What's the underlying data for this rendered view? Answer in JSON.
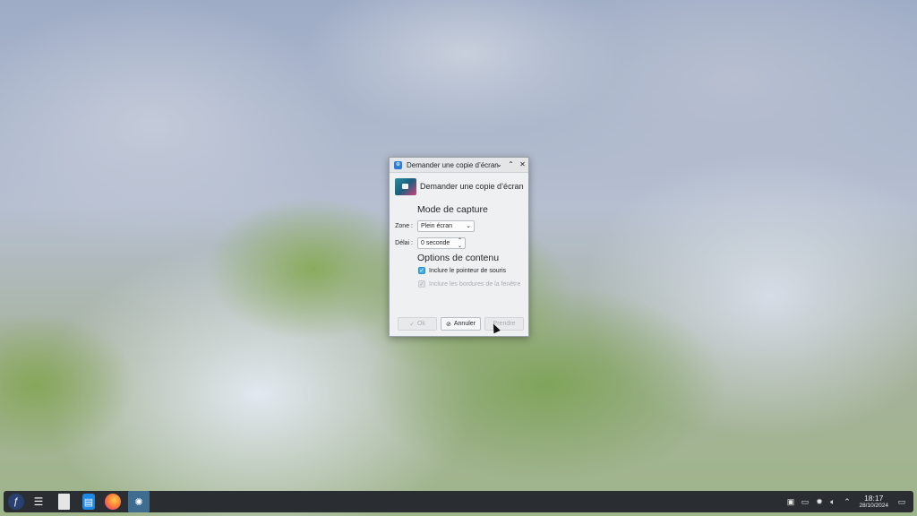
{
  "dialog": {
    "window_title": "Demander une copie d’écran",
    "header_title": "Demander une copie d’écran",
    "section_capture": "Mode de capture",
    "zone_label": "Zone :",
    "zone_value": "Plein écran",
    "delay_label": "Délai :",
    "delay_value": "0 seconde",
    "section_content": "Options de contenu",
    "include_pointer": "Inclure le pointeur de souris",
    "include_pointer_checked": true,
    "include_borders": "Inclure les bordures de la fenêtre",
    "include_borders_checked": true,
    "include_borders_enabled": false,
    "ok_label": "Ok",
    "cancel_label": "Annuler",
    "take_label": "Prendre"
  },
  "taskbar": {
    "time": "18:17",
    "date": "28/10/2024",
    "apps": [
      "fedora-launcher-icon",
      "task-switcher-icon",
      "file-icon",
      "document-viewer-icon",
      "firefox-icon",
      "kde-app-icon"
    ]
  },
  "colors": {
    "accent": "#3daee9",
    "taskbar": "#2a2e32",
    "dialog_bg": "#eff0f1"
  }
}
